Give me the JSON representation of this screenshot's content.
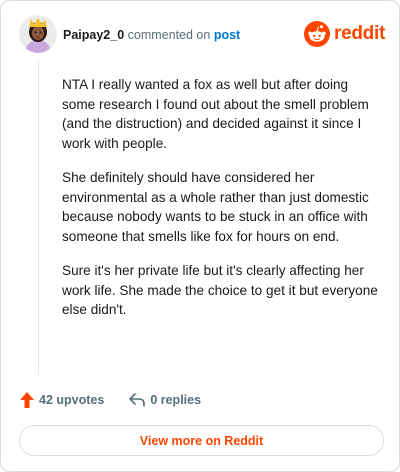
{
  "header": {
    "username": "Paipay2_0",
    "commented_on": "commented on",
    "post_link": "post",
    "brand": "reddit"
  },
  "comment": {
    "paragraphs": [
      "NTA I really wanted a fox as well but after doing some research I found out about the smell problem (and the distruction) and decided against it since I work with people.",
      "She definitely should have considered her environmental as a whole rather than just domestic because nobody wants to be stuck in an office with someone that smells like fox for hours on end.",
      "Sure it's her private life but it's clearly affecting her work life. She made the choice to get it but everyone else didn't."
    ]
  },
  "actions": {
    "upvotes": "42 upvotes",
    "replies": "0 replies"
  },
  "footer": {
    "view_more": "View more on Reddit"
  },
  "colors": {
    "brand": "#ff4500",
    "link": "#0079d3",
    "muted": "#576f76"
  },
  "icons": {
    "avatar": "user-avatar",
    "logo": "reddit-snoo-icon",
    "upvote": "upvote-arrow-icon",
    "reply": "reply-arrow-icon"
  }
}
